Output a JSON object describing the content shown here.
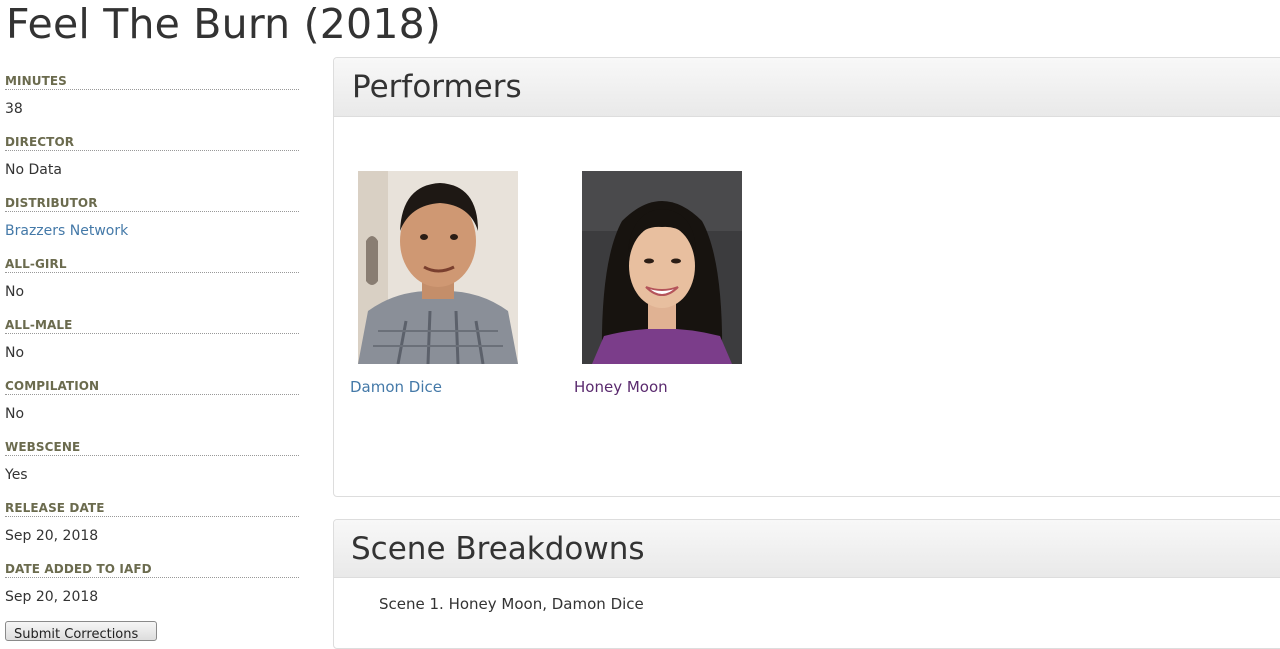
{
  "page": {
    "title": "Feel The Burn (2018)"
  },
  "info": [
    {
      "label": "MINUTES",
      "value": "38"
    },
    {
      "label": "DIRECTOR",
      "value": "No Data"
    },
    {
      "label": "DISTRIBUTOR",
      "value": "Brazzers Network"
    },
    {
      "label": "ALL-GIRL",
      "value": "No"
    },
    {
      "label": "ALL-MALE",
      "value": "No"
    },
    {
      "label": "COMPILATION",
      "value": "No"
    },
    {
      "label": "WEBSCENE",
      "value": "Yes"
    },
    {
      "label": "RELEASE DATE",
      "value": "Sep 20, 2018"
    },
    {
      "label": "DATE ADDED TO IAFD",
      "value": "Sep 20, 2018"
    }
  ],
  "submit_button": "Submit Corrections",
  "performers_panel": {
    "heading": "Performers",
    "performers": [
      {
        "name": "Damon Dice"
      },
      {
        "name": "Honey Moon"
      }
    ]
  },
  "scenes_panel": {
    "heading": "Scene Breakdowns",
    "scenes": [
      "Scene 1. Honey Moon, Damon Dice"
    ]
  },
  "colors": {
    "link": "#4479a8",
    "visited_link": "#5a2a6e",
    "label": "#6b6b4e",
    "text": "#333333"
  }
}
